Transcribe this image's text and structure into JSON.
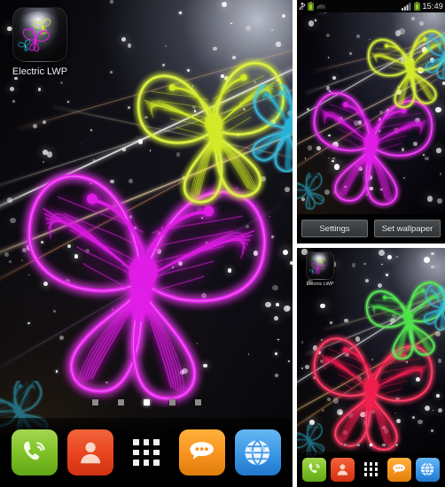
{
  "app": {
    "name": "Electric LWP",
    "icon_name": "electric-lwp-app-icon"
  },
  "panels": {
    "main": {
      "name": "Android home screen with live wallpaper",
      "shortcut_label": "Electric LWP",
      "page_count": 5,
      "active_page": 3,
      "butterflies": [
        {
          "color": "#e01ce6",
          "name": "magenta-butterfly"
        },
        {
          "color": "#d8f028",
          "name": "yellow-green-butterfly"
        },
        {
          "color": "#29c8f0",
          "name": "cyan-butterfly"
        }
      ]
    },
    "top_right": {
      "name": "Live wallpaper preview screen",
      "status_bar": {
        "time": "15:49",
        "icons": [
          "usb-icon",
          "battery-charging-icon",
          "sd-card-icon",
          "signal-icon",
          "battery-icon"
        ]
      },
      "buttons": [
        {
          "label": "Settings",
          "name": "settings-button"
        },
        {
          "label": "Set wallpaper",
          "name": "set-wallpaper-button"
        }
      ],
      "butterflies": [
        {
          "color": "#ec1fe0",
          "name": "magenta-butterfly"
        },
        {
          "color": "#cdee24",
          "name": "yellow-green-butterfly"
        },
        {
          "color": "#2ec6f5",
          "name": "cyan-butterfly"
        }
      ]
    },
    "bottom_right": {
      "name": "Home screen with red butterfly wallpaper",
      "shortcut_label": "Electric LWP",
      "page_count": 5,
      "active_page": 3,
      "butterflies": [
        {
          "color": "#f01f4e",
          "name": "red-butterfly"
        },
        {
          "color": "#4ee84a",
          "name": "green-butterfly"
        },
        {
          "color": "#2ec6f5",
          "name": "cyan-butterfly"
        }
      ]
    }
  },
  "dock": {
    "items": [
      {
        "label": "Phone",
        "icon": "phone-icon",
        "name": "dock-item-phone"
      },
      {
        "label": "Contacts",
        "icon": "contacts-icon",
        "name": "dock-item-contacts"
      },
      {
        "label": "Apps",
        "icon": "app-grid-icon",
        "name": "dock-item-apps"
      },
      {
        "label": "Messages",
        "icon": "messages-icon",
        "name": "dock-item-messages"
      },
      {
        "label": "Browser",
        "icon": "browser-icon",
        "name": "dock-item-browser"
      }
    ]
  },
  "colors": {
    "magenta": "#e01ce6",
    "yellow_green": "#d8f028",
    "cyan": "#29c8f0",
    "red": "#f01f4e",
    "green": "#4ee84a",
    "background": "#000000"
  }
}
